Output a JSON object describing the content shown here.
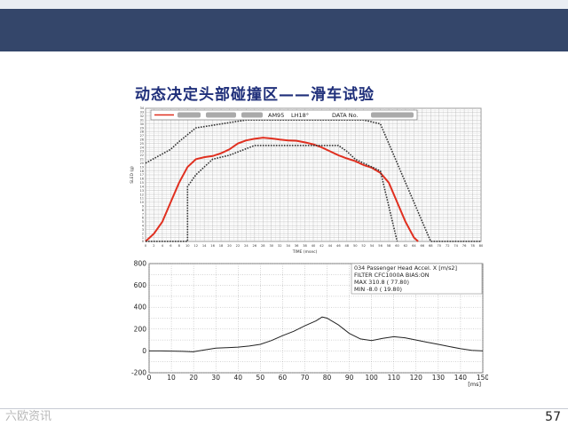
{
  "slide": {
    "title": "动态决定头部碰撞区——滑车试验",
    "page_number": "57",
    "watermark": "六欧资讯",
    "colors": {
      "header": "#34466a",
      "title": "#1f2f7a",
      "accent_red": "#e03020"
    }
  },
  "chart_data": [
    {
      "type": "line",
      "legend_text": [
        "AM95",
        "LH18°",
        "DATA No."
      ],
      "xlabel": "TIME (msec)",
      "ylabel": "SLED (g)",
      "xlim": [
        0,
        80
      ],
      "ylim": [
        0,
        34
      ],
      "x_ticks": [
        "0",
        "2",
        "4",
        "6",
        "8",
        "10",
        "12",
        "14",
        "16",
        "18",
        "20",
        "22",
        "24",
        "26",
        "28",
        "30",
        "32",
        "34",
        "36",
        "38",
        "40",
        "42",
        "44",
        "46",
        "48",
        "50",
        "52",
        "54",
        "56",
        "58",
        "60",
        "62",
        "64",
        "66",
        "68",
        "70",
        "72",
        "74",
        "76",
        "78",
        "80"
      ],
      "y_ticks": [
        "0",
        "1",
        "2",
        "3",
        "4",
        "5",
        "6",
        "7",
        "8",
        "9",
        "10",
        "11",
        "12",
        "13",
        "14",
        "15",
        "16",
        "17",
        "18",
        "19",
        "20",
        "21",
        "22",
        "23",
        "24",
        "25",
        "26",
        "27",
        "28",
        "29",
        "30",
        "31",
        "32",
        "33",
        "34"
      ],
      "grid": true,
      "series": [
        {
          "style": "red-solid",
          "color": "#e03020",
          "x": [
            0,
            2,
            4,
            6,
            8,
            10,
            12,
            14,
            16,
            18,
            20,
            22,
            24,
            26,
            28,
            30,
            32,
            34,
            36,
            38,
            40,
            42,
            44,
            46,
            48,
            50,
            52,
            54,
            56,
            58,
            60,
            62,
            64,
            65
          ],
          "y": [
            0,
            2,
            5,
            10,
            15,
            19,
            21,
            21.5,
            21.8,
            22.5,
            23.5,
            25,
            25.8,
            26.2,
            26.5,
            26.3,
            26,
            25.8,
            25.7,
            25.3,
            24.8,
            24,
            23,
            22,
            21.2,
            20.5,
            19.5,
            18.8,
            17.5,
            15,
            10,
            5,
            1,
            0
          ]
        },
        {
          "style": "black-dotted-inner",
          "color": "#333333",
          "x": [
            0,
            10,
            10,
            12,
            14,
            16,
            20,
            26,
            30,
            34,
            40,
            46,
            48,
            50,
            52,
            56,
            60,
            60
          ],
          "y": [
            0,
            0,
            14,
            17,
            19,
            21,
            22,
            24.5,
            24.5,
            24.5,
            24.5,
            24.5,
            23,
            21,
            20,
            18,
            0,
            0
          ]
        },
        {
          "style": "black-dotted-envelope",
          "color": "#333333",
          "x": [
            0,
            6,
            8,
            12,
            24,
            52,
            56,
            68,
            80
          ],
          "y": [
            20,
            23.5,
            25.5,
            29,
            31,
            31,
            30,
            0,
            0
          ]
        }
      ]
    },
    {
      "type": "line",
      "info_lines": [
        "034 Passenger Head Accel. X [m/s2]",
        "FILTER CFC1000A BIAS:ON",
        "MAX   310.8 (  77.80)",
        "MIN    -8.0 (  19.80)"
      ],
      "x_unit": "[ms]",
      "xlim": [
        0,
        150
      ],
      "ylim": [
        -200,
        800
      ],
      "x_ticks": [
        "0",
        "10",
        "20",
        "30",
        "40",
        "50",
        "60",
        "70",
        "80",
        "90",
        "100",
        "110",
        "120",
        "130",
        "140",
        "150"
      ],
      "y_ticks": [
        "800",
        "600",
        "400",
        "200",
        "0",
        "-200"
      ],
      "grid": true,
      "series": [
        {
          "color": "#222222",
          "x": [
            0,
            5,
            10,
            15,
            19.8,
            25,
            30,
            35,
            40,
            45,
            50,
            55,
            60,
            65,
            70,
            75,
            77.8,
            80,
            85,
            90,
            95,
            100,
            105,
            110,
            115,
            120,
            125,
            130,
            135,
            140,
            145,
            150
          ],
          "y": [
            0,
            0,
            -2,
            -4,
            -8,
            10,
            25,
            30,
            35,
            45,
            60,
            95,
            140,
            180,
            230,
            275,
            310.8,
            300,
            240,
            160,
            110,
            95,
            115,
            130,
            120,
            100,
            80,
            60,
            40,
            20,
            5,
            0
          ]
        }
      ]
    }
  ]
}
